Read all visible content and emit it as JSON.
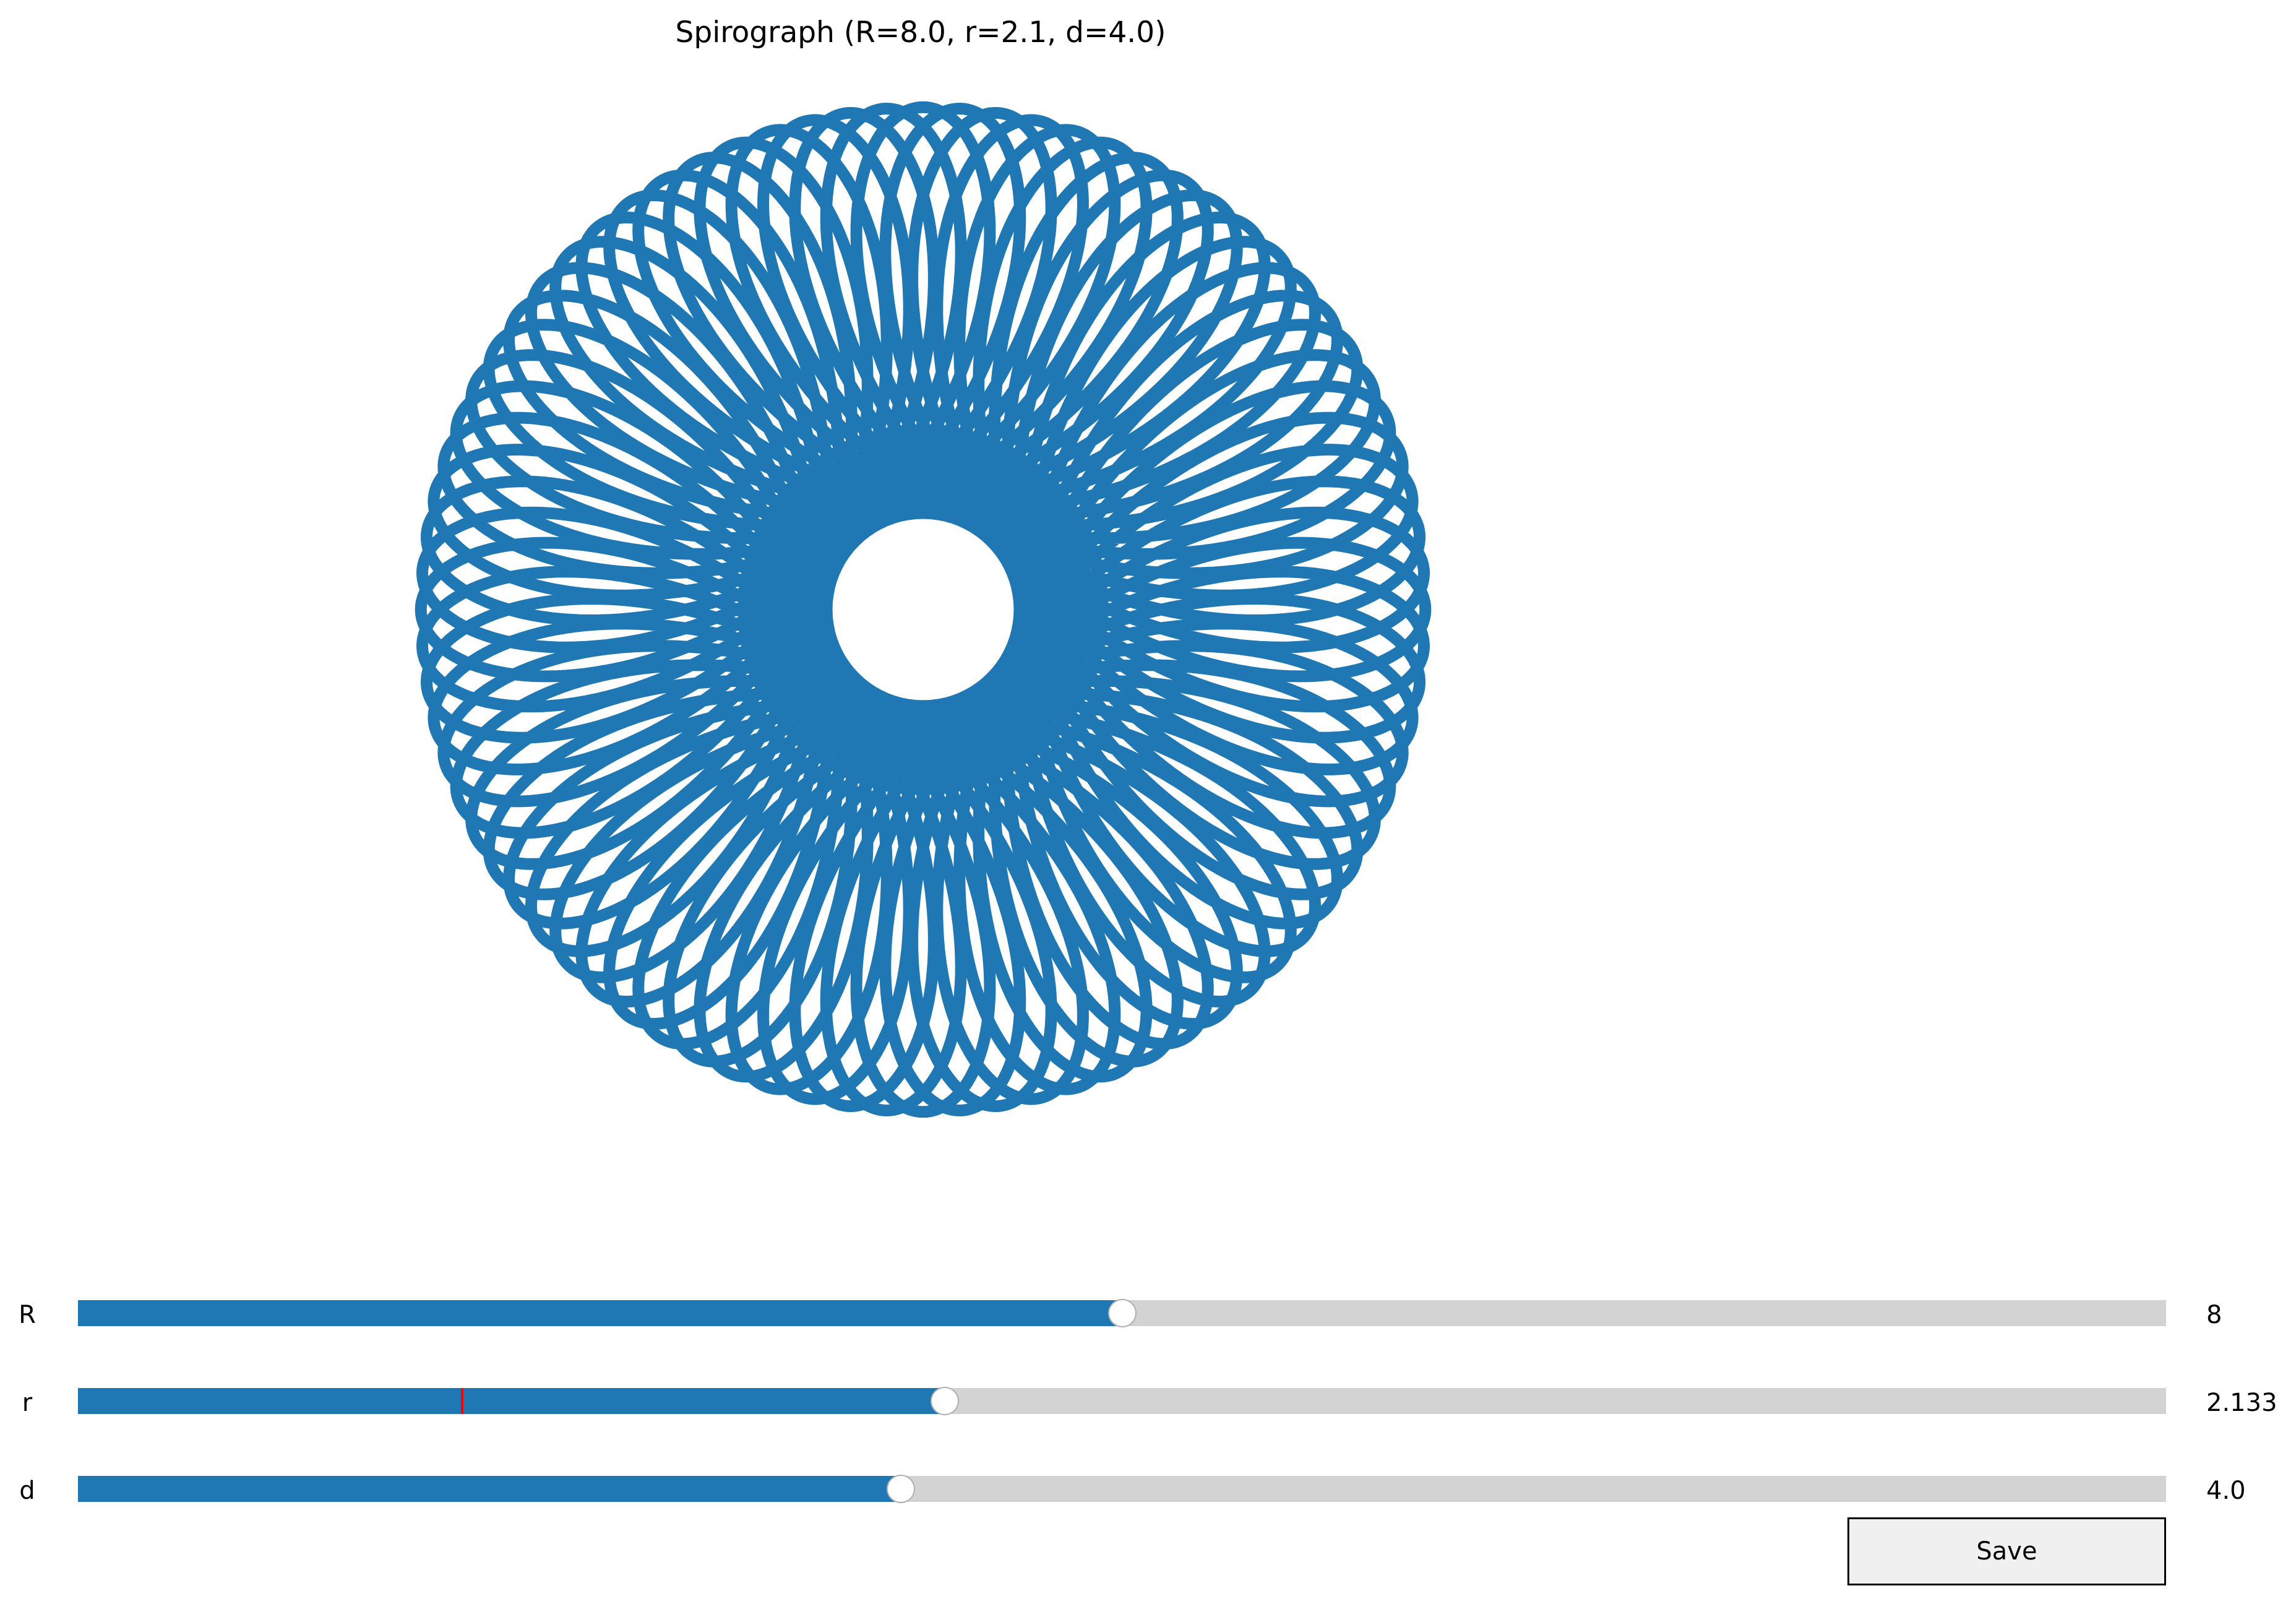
{
  "title": "Spirograph (R=8.0, r=2.1, d=4.0)",
  "curve": {
    "R": 8.0,
    "r": 2.1,
    "d": 4.0,
    "color": "#1f77b4"
  },
  "sliders": [
    {
      "label": "R",
      "value_text": "8",
      "fraction": 0.5
    },
    {
      "label": "r",
      "value_text": "2.133",
      "fraction": 0.415,
      "marker_fraction": 0.184
    },
    {
      "label": "d",
      "value_text": "4.0",
      "fraction": 0.394
    }
  ],
  "save_button": {
    "label": "Save"
  },
  "colors": {
    "accent": "#1f77b4",
    "track": "#d3d3d3",
    "marker": "#ff0000",
    "button_bg": "#f0f0f0"
  }
}
